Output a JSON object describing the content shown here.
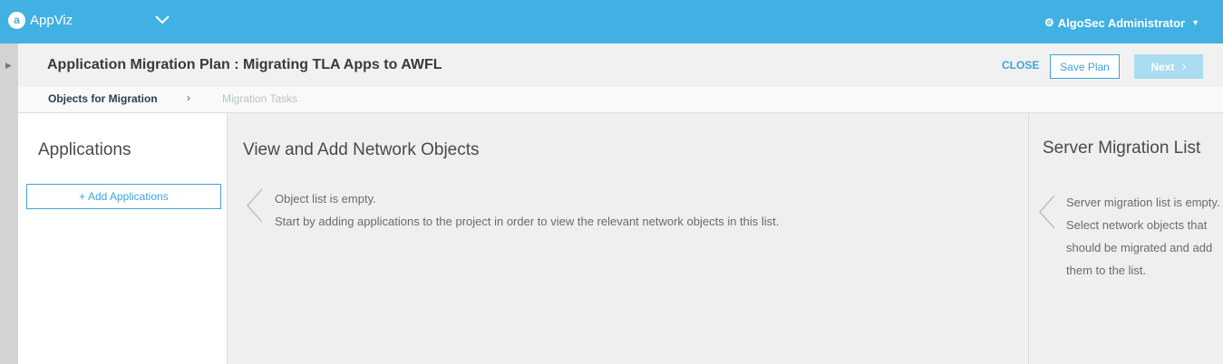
{
  "topbar": {
    "logo_glyph": "a",
    "app_name": "AppViz",
    "app_switch_icon": "chevron-down-icon",
    "user_icon": "gear-icon",
    "user_name": "AlgoSec Administrator",
    "user_caret": "▼"
  },
  "rail": {
    "toggle_glyph": "▶"
  },
  "header": {
    "title": "Application Migration Plan : Migrating TLA Apps to AWFL",
    "close_label": "CLOSE",
    "save_label": "Save Plan",
    "next_label": "Next",
    "next_chevron": "›"
  },
  "steps": {
    "current": "Objects for Migration",
    "separator": "›",
    "next": "Migration Tasks"
  },
  "applications": {
    "title": "Applications",
    "add_label": "+ Add Applications"
  },
  "network_objects": {
    "title": "View and Add Network Objects",
    "empty_line1": "Object list is empty.",
    "empty_line2": "Start by adding applications to the project in order to view the relevant network objects in this list."
  },
  "server_migration": {
    "title": "Server Migration List",
    "empty_text": "Server migration list is empty. Select network objects that should be migrated and add them to the list."
  },
  "colors": {
    "brand": "#41b0e3",
    "accent": "#41a3d6",
    "disabled": "#aadcf2"
  }
}
